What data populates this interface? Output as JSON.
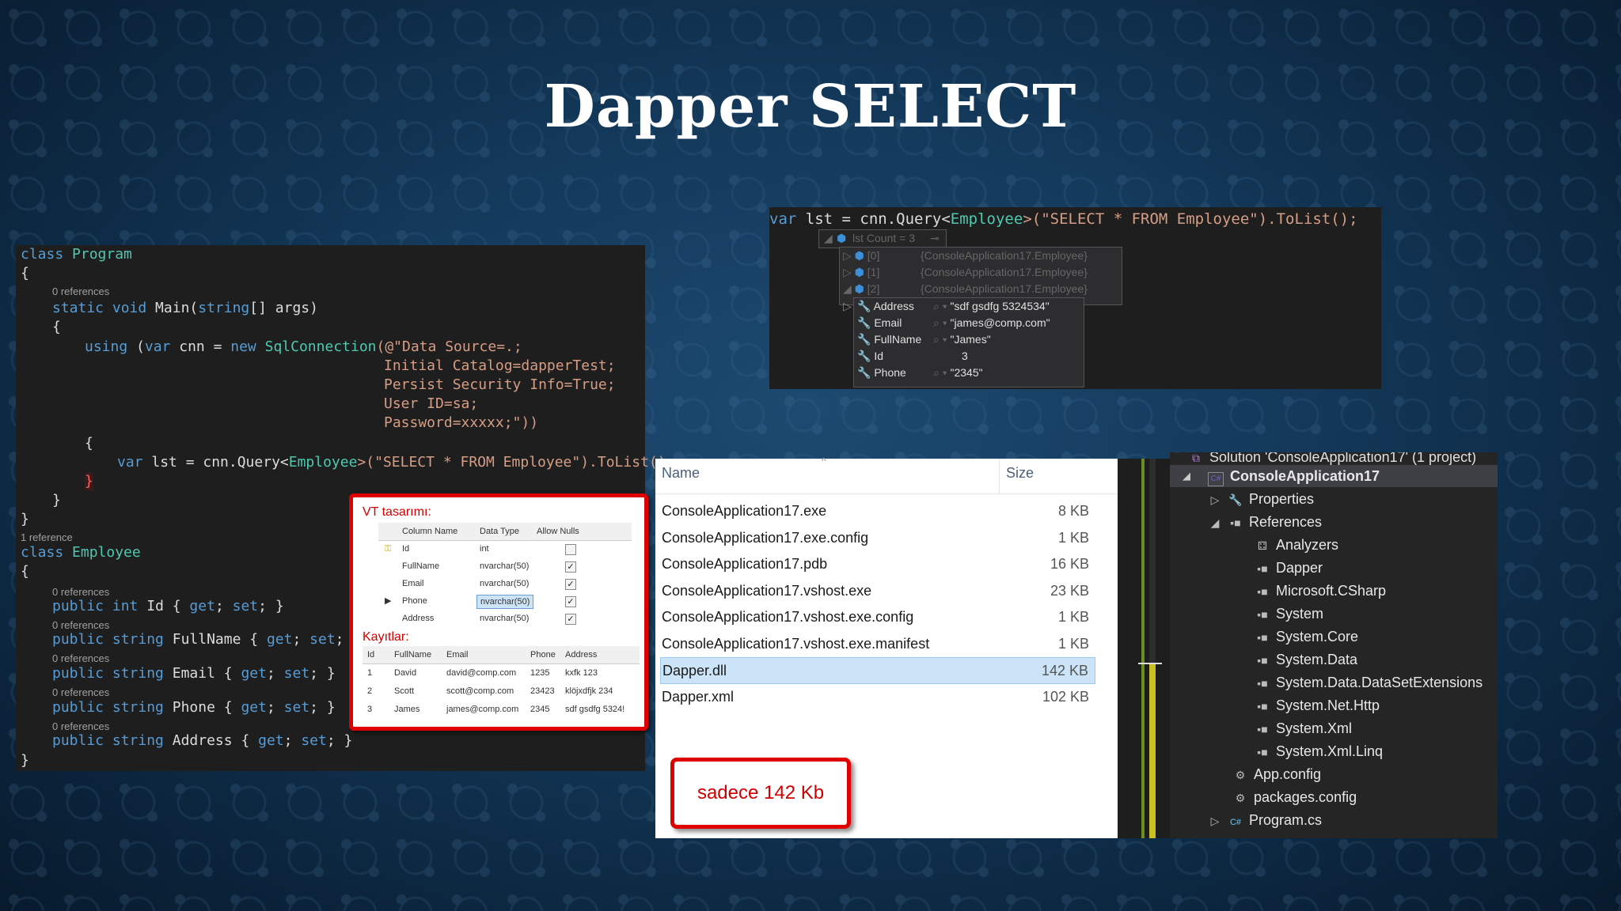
{
  "title": "Dapper SELECT",
  "code": {
    "ref0": "0 references",
    "ref1": "1 reference",
    "lines": {
      "class_kw": "class",
      "class_program": "Program",
      "brace_open": "{",
      "brace_close": "}",
      "main_static": "static void",
      "main_name": " Main(",
      "main_string": "string",
      "main_args": "[] args)",
      "using_kw": "using",
      "using_var": "var",
      "using_rest1": " cnn = ",
      "using_new": "new",
      "using_type": "SqlConnection",
      "using_str1": "(@\"Data Source=.;",
      "str2": "Initial Catalog=dapperTest;",
      "str3": "Persist Security Info=True;",
      "str4": "User ID=sa;",
      "str5": "Password=xxxxx;\"))",
      "q_var": "var",
      "q_rest": " lst = cnn.Query<",
      "q_type": "Employee",
      "q_str": ">(\"SELECT * FROM Employee\").ToList();",
      "class_employee": "Employee",
      "public_kw": "public",
      "int_kw": "int",
      "string_kw": "string",
      "get_kw": "get",
      "set_kw": "set",
      "prop_id": " Id { ",
      "prop_fullname": " FullName { ",
      "prop_email": " Email { ",
      "prop_phone": " Phone { ",
      "prop_address": " Address { ",
      "semi": "; ",
      "close": "; }"
    }
  },
  "vt_callout": {
    "design_label": "VT tasarımı:",
    "design_headers": [
      "Column Name",
      "Data Type",
      "Allow Nulls"
    ],
    "design_rows": [
      {
        "name": "Id",
        "type": "int",
        "null": false
      },
      {
        "name": "FullName",
        "type": "nvarchar(50)",
        "null": true
      },
      {
        "name": "Email",
        "type": "nvarchar(50)",
        "null": true
      },
      {
        "name": "Phone",
        "type": "nvarchar(50)",
        "null": true
      },
      {
        "name": "Address",
        "type": "nvarchar(50)",
        "null": true
      }
    ],
    "records_label": "Kayıtlar:",
    "record_headers": [
      "Id",
      "FullName",
      "Email",
      "Phone",
      "Address"
    ],
    "records": [
      [
        "1",
        "David",
        "david@comp.com",
        "1235",
        "kxfk 123"
      ],
      [
        "2",
        "Scott",
        "scott@comp.com",
        "23423",
        "klöjxdfjk 234"
      ],
      [
        "3",
        "James",
        "james@comp.com",
        "2345",
        "sdf gsdfg 5324!"
      ]
    ]
  },
  "debug": {
    "line_var": "var",
    "line_rest": " lst = cnn.Query<",
    "line_type": "Employee",
    "line_str": ">(\"SELECT * FROM Employee\").ToList();",
    "count_label": "lst  Count = 3",
    "items": [
      {
        "idx": "[0]",
        "val": "{ConsoleApplication17.Employee}"
      },
      {
        "idx": "[1]",
        "val": "{ConsoleApplication17.Employee}"
      },
      {
        "idx": "[2]",
        "val": "{ConsoleApplication17.Employee}"
      }
    ],
    "props": [
      {
        "name": "Address",
        "val": "\"sdf gsdfg 5324534\""
      },
      {
        "name": "Email",
        "val": "\"james@comp.com\""
      },
      {
        "name": "FullName",
        "val": "\"James\""
      },
      {
        "name": "Id",
        "val": "3"
      },
      {
        "name": "Phone",
        "val": "\"2345\""
      }
    ]
  },
  "explorer": {
    "col_name": "Name",
    "col_size": "Size",
    "files": [
      {
        "name": "ConsoleApplication17.exe",
        "size": "8 KB"
      },
      {
        "name": "ConsoleApplication17.exe.config",
        "size": "1 KB"
      },
      {
        "name": "ConsoleApplication17.pdb",
        "size": "16 KB"
      },
      {
        "name": "ConsoleApplication17.vshost.exe",
        "size": "23 KB"
      },
      {
        "name": "ConsoleApplication17.vshost.exe.config",
        "size": "1 KB"
      },
      {
        "name": "ConsoleApplication17.vshost.exe.manifest",
        "size": "1 KB"
      },
      {
        "name": "Dapper.dll",
        "size": "142 KB"
      },
      {
        "name": "Dapper.xml",
        "size": "102 KB"
      }
    ],
    "callout": "sadece 142 Kb"
  },
  "solution": {
    "header": "Solution 'ConsoleApplication17' (1 project)",
    "project": "ConsoleApplication17",
    "properties": "Properties",
    "references": "References",
    "refs": [
      "Analyzers",
      "Dapper",
      "Microsoft.CSharp",
      "System",
      "System.Core",
      "System.Data",
      "System.Data.DataSetExtensions",
      "System.Net.Http",
      "System.Xml",
      "System.Xml.Linq"
    ],
    "files": [
      "App.config",
      "packages.config",
      "Program.cs"
    ]
  }
}
